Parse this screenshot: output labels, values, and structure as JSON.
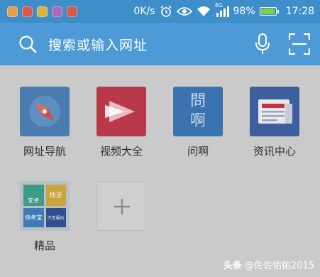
{
  "status_bar": {
    "speed": "0K/s",
    "network_type": "4G",
    "battery_percent": "98%",
    "battery_level": 0.98,
    "time": "17:28",
    "notification_icons": [
      "app-icon-orange",
      "app-icon-red",
      "app-icon-yellow",
      "app-icon-purple",
      "app-icon-red"
    ]
  },
  "search_bar": {
    "placeholder": "搜索或输入网址",
    "icons": [
      "search-icon",
      "mic-icon",
      "scan-icon"
    ]
  },
  "shortcuts": [
    {
      "label": "网址导航",
      "icon": "compass-icon",
      "color": "#4a7cb0"
    },
    {
      "label": "视频大全",
      "icon": "video-play-icon",
      "color": "#b83a48"
    },
    {
      "label": "问啊",
      "icon": "wenah-icon",
      "icon_text_top": "問",
      "icon_text_bottom": "啊",
      "color": "#3b73b0"
    },
    {
      "label": "资讯中心",
      "icon": "news-icon",
      "color": "#3d5fa0"
    },
    {
      "label": "精品",
      "icon": "app-folder-icon",
      "color": "#b8bfc6",
      "folder_apps": [
        "安卓",
        "快牙",
        "快考宝",
        "汽车报价"
      ]
    },
    {
      "label": "",
      "icon": "add-icon",
      "color": "#cfcfcf"
    }
  ],
  "watermark": {
    "badge": "头条",
    "text": "@佐佐佑佑2015"
  },
  "colors": {
    "status_bar_bg": "#3d8ec9",
    "search_bar_bg": "#4e9ad6",
    "content_bg": "#cacaca"
  }
}
